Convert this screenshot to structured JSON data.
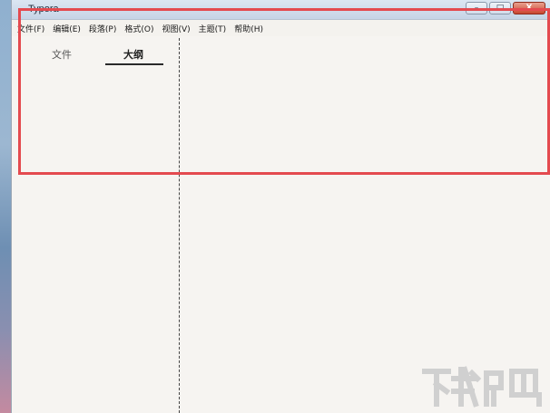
{
  "window": {
    "title": "Typora",
    "controls": {
      "minimize": "–",
      "maximize": "□",
      "close": "X"
    }
  },
  "menubar": {
    "items": [
      {
        "label": "文件(F)"
      },
      {
        "label": "编辑(E)"
      },
      {
        "label": "段落(P)"
      },
      {
        "label": "格式(O)"
      },
      {
        "label": "视图(V)"
      },
      {
        "label": "主题(T)"
      },
      {
        "label": "帮助(H)"
      }
    ]
  },
  "sidebar": {
    "tabs": [
      {
        "label": "文件",
        "active": false
      },
      {
        "label": "大纲",
        "active": true
      }
    ]
  },
  "colors": {
    "highlight": "#e44a4f",
    "window_background": "#f6f4f1",
    "watermark": "#d0d0d0"
  },
  "watermark": {
    "logo": "download-site-logo"
  }
}
